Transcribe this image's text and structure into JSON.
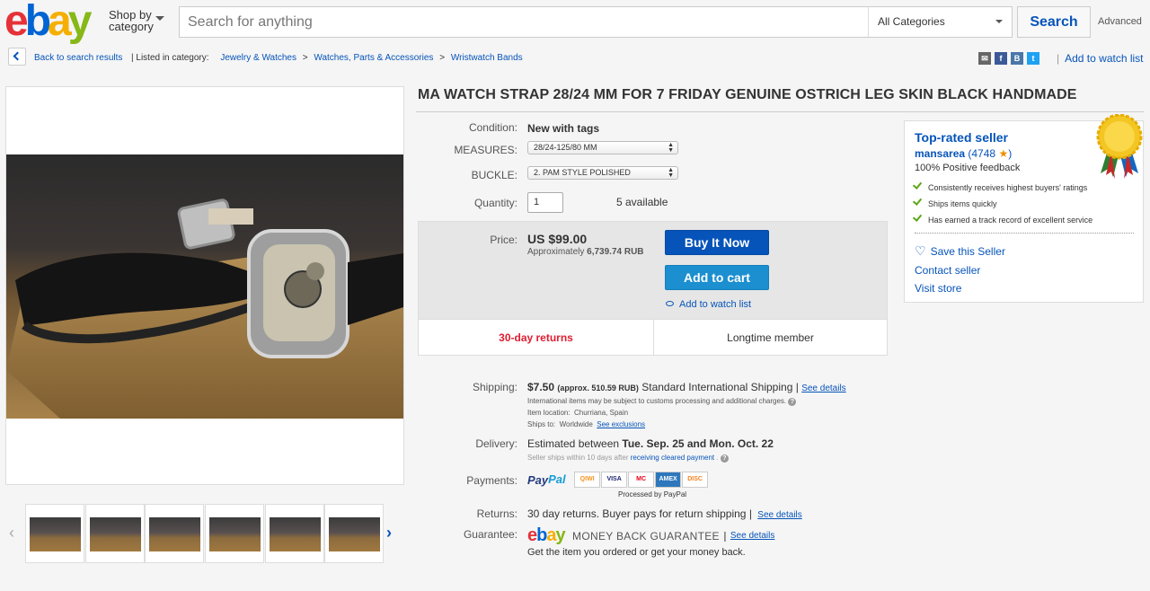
{
  "header": {
    "logo": {
      "e": "e",
      "b": "b",
      "a": "a",
      "y": "y"
    },
    "shop_by_line1": "Shop by",
    "shop_by_line2": "category",
    "search_placeholder": "Search for anything",
    "category": "All Categories",
    "search_button": "Search",
    "advanced": "Advanced"
  },
  "breadcrumb": {
    "back": "Back to search results",
    "listed_in": "| Listed in category:",
    "items": [
      "Jewelry & Watches",
      "Watches, Parts & Accessories",
      "Wristwatch Bands"
    ],
    "separator": ">",
    "share_icons": {
      "fb": "f",
      "vk": "B",
      "tw": "t"
    },
    "add_to_watch_list": "Add to watch list"
  },
  "item": {
    "title": "MA WATCH STRAP 28/24 MM FOR 7 FRIDAY GENUINE OSTRICH LEG SKIN BLACK HANDMADE",
    "condition_label": "Condition:",
    "condition": "New with tags",
    "measures_label": "MEASURES:",
    "measures": "28/24-125/80 MM",
    "buckle_label": "BUCKLE:",
    "buckle": "2. PAM STYLE POLISHED",
    "quantity_label": "Quantity:",
    "quantity": "1",
    "available": "5 available",
    "price_label": "Price:",
    "price": "US $99.00",
    "approx_prefix": "Approximately",
    "approx_value": "6,739.74 RUB",
    "buy_now": "Buy It Now",
    "add_to_cart": "Add to cart",
    "add_to_watch_list": "Add to watch list",
    "returns_badge": "30-day returns",
    "member_badge": "Longtime member"
  },
  "seller": {
    "badge": "Top-rated seller",
    "name": "mansarea",
    "feedback_count": "(4748",
    "feedback_close": ")",
    "positive": "100% Positive feedback",
    "bullets": [
      "Consistently receives highest buyers' ratings",
      "Ships items quickly",
      "Has earned a track record of excellent service"
    ],
    "save": "Save this Seller",
    "contact": "Contact seller",
    "store": "Visit store"
  },
  "shipping": {
    "label": "Shipping:",
    "cost": "$7.50",
    "approx": "(approx. 510.59 RUB)",
    "method": "Standard International Shipping",
    "sep": "|",
    "see_details": "See details",
    "customs": "International items may be subject to customs processing and additional charges.",
    "location_label": "Item location:",
    "location": "Churriana, Spain",
    "ships_to_label": "Ships to:",
    "ships_to": "Worldwide",
    "see_exclusions": "See exclusions"
  },
  "delivery": {
    "label": "Delivery:",
    "prefix": "Estimated between",
    "dates": "Tue. Sep. 25 and Mon. Oct. 22",
    "note_prefix": "Seller ships within 10 days after",
    "note_link": "receiving cleared payment",
    "note_suffix": "."
  },
  "payments": {
    "label": "Payments:",
    "paypal_a": "Pay",
    "paypal_b": "Pal",
    "cards": [
      "QIWI",
      "VISA",
      "MC",
      "AMEX",
      "DISC"
    ],
    "processed": "Processed by PayPal"
  },
  "returns": {
    "label": "Returns:",
    "text": "30 day returns. Buyer pays for return shipping",
    "sep": "|",
    "see_details": "See details"
  },
  "guarantee": {
    "label": "Guarantee:",
    "title": "MONEY BACK GUARANTEE",
    "sep": "|",
    "see_details": "See details",
    "text": "Get the item you ordered or get your money back."
  },
  "colors": {
    "link": "#0654ba",
    "buy": "#0654ba",
    "cart": "#1b8fd0",
    "returns": "#dd1e31"
  }
}
